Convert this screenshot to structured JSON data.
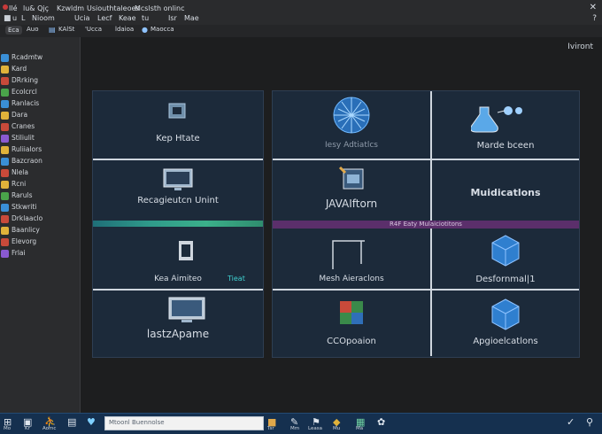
{
  "menubar": {
    "items": [
      "Ilé",
      "lu& Qjç",
      "Kzwldm",
      "Usiouthtaleoes",
      "Mcslsth onlinc"
    ],
    "items2": [
      "u",
      "L",
      "Nioom",
      "Ucia",
      "Lecf",
      "Keae",
      "tu",
      "Isr",
      "Mae"
    ],
    "close": "✕",
    "help": "?"
  },
  "tabbar": {
    "items": [
      "Eca",
      "Auo",
      "KAlSt",
      "'Ucca",
      "ldaioa",
      "Maocca"
    ]
  },
  "sidebar": {
    "items": [
      {
        "label": "Rcadmtw",
        "hl": "",
        "color": "#3a8fd6"
      },
      {
        "label": "Kard",
        "hl": "",
        "color": "#e0b23a"
      },
      {
        "label": "DRrking",
        "hl": "",
        "color": "#c84a3a"
      },
      {
        "label": "Ecolcrcl",
        "hl": "",
        "color": "#4aa34a"
      },
      {
        "label": "Ranlacis",
        "hl": "",
        "color": "#3a8fd6"
      },
      {
        "label": "Dara",
        "hl": "",
        "color": "#e0b23a"
      },
      {
        "label": "Cranes",
        "hl": "",
        "color": "#c84a3a"
      },
      {
        "label": "Stiliulit",
        "hl": "",
        "color": "#8a5ad0"
      },
      {
        "label": "Ruliialors",
        "hl": "",
        "color": "#e0b23a"
      },
      {
        "label": "Bazcraon",
        "hl": "",
        "color": "#3a8fd6"
      },
      {
        "label": "Nlela",
        "hl": "",
        "color": "#c84a3a"
      },
      {
        "label": "Rcni",
        "hl": "",
        "color": "#e0b23a"
      },
      {
        "label": "Raruls",
        "hl": "",
        "color": "#4aa34a"
      },
      {
        "label": "Stkwriti",
        "hl": "",
        "color": "#3a8fd6"
      },
      {
        "label": "Drklaaclo",
        "hl": "",
        "color": "#c84a3a"
      },
      {
        "label": "Baanlicy",
        "hl": "",
        "color": "#e0b23a"
      },
      {
        "label": "Elevorg",
        "hl": "",
        "color": "#c84a3a"
      },
      {
        "label": "Frlai",
        "hl": "",
        "color": "#8a5ad0"
      }
    ]
  },
  "content": {
    "corner_label": "Iviront",
    "tiles": {
      "keep": "Kep Htate",
      "easy": "Iesy Adtiatlcs",
      "marde": "Marde bceen",
      "recognition": "Recagieutcn Unint",
      "java": "JAVAIftorn",
      "multi": "Muidicatlons",
      "kea": "Kea Aimiteo",
      "kea_badge": "Tieat",
      "mesh": "Mesh Aieraclons",
      "desform": "Desfornmal|1",
      "lastz": "lastzApame",
      "ccop": "CCOpoaion",
      "app": "Apgioelcatlons"
    },
    "purple_strip": "R4F Eaty Mulaiciotitons"
  },
  "taskbar": {
    "labels": [
      "Mo",
      "Kr",
      "Aomc",
      "Tsr",
      "Mm",
      "Leasa",
      "Mu",
      "Ma"
    ],
    "search_placeholder": "Mtoonl Buennolse"
  }
}
